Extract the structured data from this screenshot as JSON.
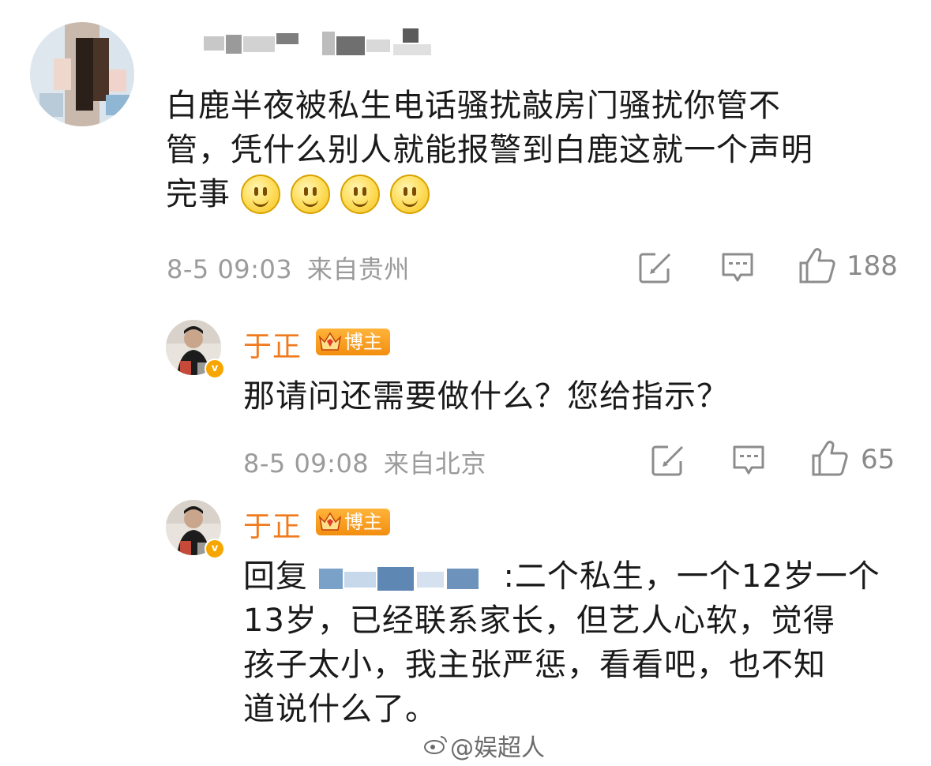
{
  "comment": {
    "text_line1": "白鹿半夜被私生电话骚扰敲房门骚扰你管不",
    "text_line2": "管，凭什么别人就能报警到白鹿这就一个声明",
    "text_line3": "完事",
    "emoji": [
      "smile",
      "smile",
      "smile",
      "smile"
    ],
    "time": "8-5 09:03",
    "location": "来自贵州",
    "likes": "188"
  },
  "replies": [
    {
      "author": "于正",
      "badge": "博主",
      "text": "那请问还需要做什么？您给指示？",
      "time": "8-5 09:08",
      "location": "来自北京",
      "likes": "65"
    },
    {
      "author": "于正",
      "badge": "博主",
      "reply_prefix": "回复",
      "text_line1_tail": ":二个私生，一个12岁一个",
      "text_line2": "13岁，已经联系家长，但艺人心软，觉得",
      "text_line3": "孩子太小，我主张严惩，看看吧，也不知",
      "text_line4": "道说什么了。"
    }
  ],
  "watermark": "@娱超人",
  "colors": {
    "author": "#f07a1e",
    "meta": "#9b9b9b",
    "badge": "#f28e10"
  },
  "icons": [
    "edit-icon",
    "comment-icon",
    "like-icon",
    "verified-icon",
    "crown-icon",
    "weibo-icon"
  ]
}
